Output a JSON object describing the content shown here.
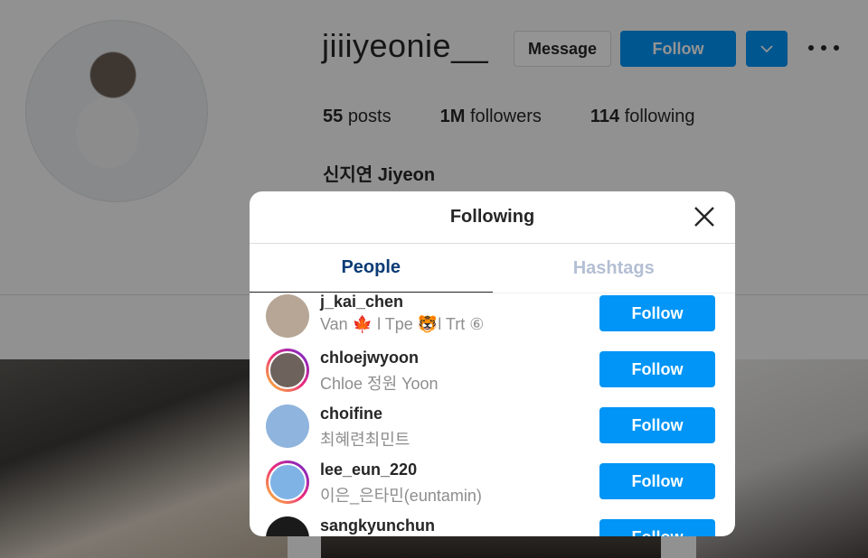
{
  "profile": {
    "username": "jiiiyeonie__",
    "message_label": "Message",
    "follow_label": "Follow",
    "stats": {
      "posts_count": "55",
      "posts_label": "posts",
      "followers_count": "1M",
      "followers_label": "followers",
      "following_count": "114",
      "following_label": "following"
    },
    "full_name": "신지연 Jiyeon"
  },
  "modal": {
    "title": "Following",
    "tabs": [
      {
        "label": "People",
        "active": true
      },
      {
        "label": "Hashtags",
        "active": false
      }
    ],
    "users": [
      {
        "username": "j_kai_chen",
        "subtitle": "Van 🍁 l Tpe 🐯l Trt ⑥",
        "button": "Follow",
        "story_ring": false,
        "avatar_color": "#b7a695"
      },
      {
        "username": "chloejwyoon",
        "subtitle": "Chloe 정원 Yoon",
        "button": "Follow",
        "story_ring": true,
        "avatar_color": "#6e625c"
      },
      {
        "username": "choifine",
        "subtitle": "최혜련최민트",
        "button": "Follow",
        "story_ring": false,
        "avatar_color": "#8fb4dd"
      },
      {
        "username": "lee_eun_220",
        "subtitle": "이은_은타민(euntamin)",
        "button": "Follow",
        "story_ring": true,
        "avatar_color": "#7fb3e6"
      },
      {
        "username": "sangkyunchun",
        "subtitle": "",
        "button": "Follow",
        "story_ring": false,
        "avatar_color": "#1a1a1a"
      }
    ]
  },
  "colors": {
    "primary_button": "#0095f6",
    "active_tab_text": "#0c3b75",
    "inactive_tab_text": "#b4bfd4",
    "subtitle_text": "#8e8e8e"
  },
  "icons": {
    "close": "close-icon",
    "dropdown": "chevron-down-icon",
    "more": "more-options-icon"
  }
}
